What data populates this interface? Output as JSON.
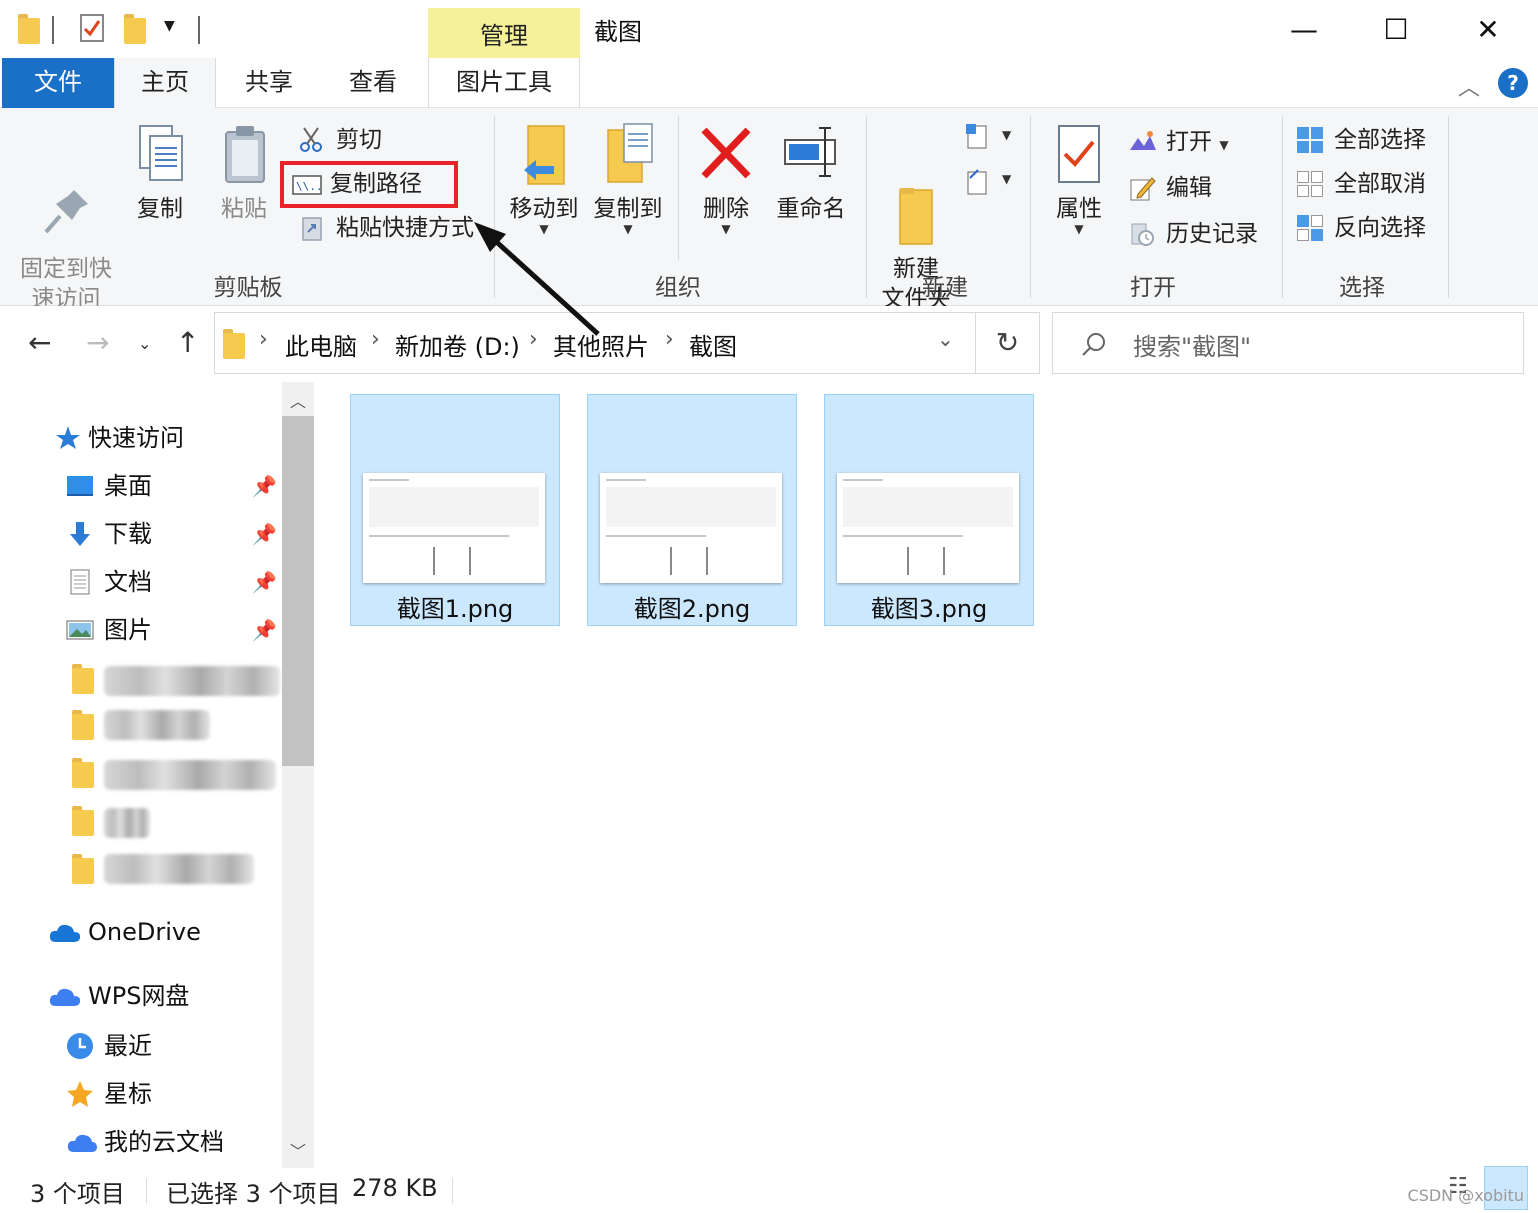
{
  "window": {
    "title": "截图",
    "contextual_tab": "管理",
    "minimize_glyph": "—",
    "maximize_glyph": "☐",
    "close_glyph": "✕"
  },
  "tabs": {
    "file": "文件",
    "home": "主页",
    "share": "共享",
    "view": "查看",
    "picture_tools": "图片工具",
    "help": "?"
  },
  "ribbon": {
    "clipboard": {
      "label": "剪贴板",
      "pin_quick_access": "固定到快\n速访问",
      "copy": "复制",
      "paste": "粘贴",
      "cut": "剪切",
      "copy_path": "复制路径",
      "paste_shortcut": "粘贴快捷方式"
    },
    "organize": {
      "label": "组织",
      "move_to": "移动到",
      "copy_to": "复制到",
      "delete": "删除",
      "rename": "重命名"
    },
    "new": {
      "label": "新建",
      "new_folder": "新建\n文件夹"
    },
    "open": {
      "label": "打开",
      "properties": "属性",
      "open": "打开",
      "edit": "编辑",
      "history": "历史记录"
    },
    "select": {
      "label": "选择",
      "select_all": "全部选择",
      "select_none": "全部取消",
      "invert": "反向选择"
    }
  },
  "address": {
    "crumbs": [
      "此电脑",
      "新加卷 (D:)",
      "其他照片",
      "截图"
    ],
    "search_placeholder": "搜索\"截图\""
  },
  "nav": {
    "quick_access": "快速访问",
    "pinned": [
      "桌面",
      "下载",
      "文档",
      "图片"
    ],
    "onedrive": "OneDrive",
    "wps": "WPS网盘",
    "wps_items": [
      "最近",
      "星标",
      "我的云文档"
    ]
  },
  "files": [
    {
      "name": "截图1.png"
    },
    {
      "name": "截图2.png"
    },
    {
      "name": "截图3.png"
    }
  ],
  "status": {
    "count": "3 个项目",
    "selection": "已选择 3 个项目",
    "size": "278 KB",
    "watermark": "CSDN @xobitu"
  },
  "colors": {
    "accent": "#1a6fc6",
    "selection_bg": "#cce8ff",
    "highlight": "#e8232a",
    "manage_tab": "#f5f09a"
  }
}
